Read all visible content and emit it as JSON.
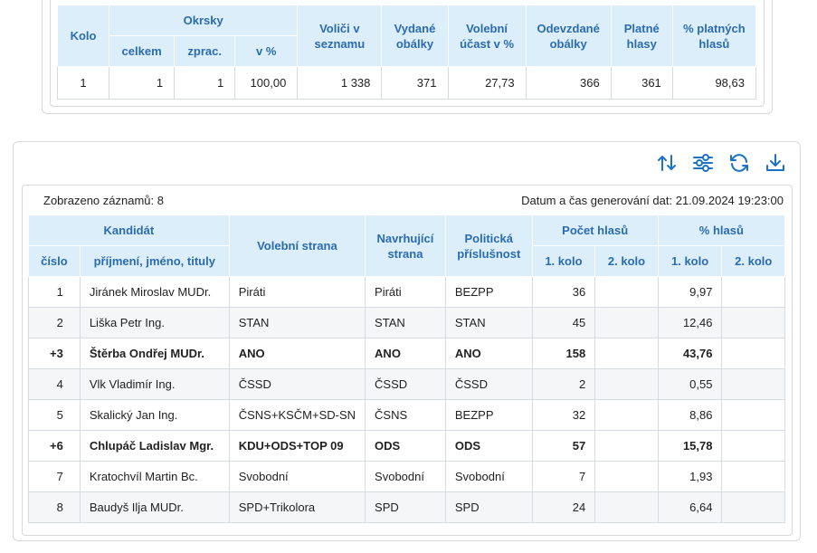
{
  "summary": {
    "headers": {
      "kolo": "Kolo",
      "okrsky": "Okrsky",
      "celkem": "celkem",
      "zprac": "zprac.",
      "v_pct": "v %",
      "volici": "Voliči v seznamu",
      "vydane": "Vydané obálky",
      "ucast": "Volební účast v %",
      "odevzdane": "Odevzdané obálky",
      "platne": "Platné hlasy",
      "pct_platnych": "% platných hlasů"
    },
    "row": {
      "kolo": "1",
      "celkem": "1",
      "zprac": "1",
      "v_pct": "100,00",
      "volici": "1 338",
      "vydane": "371",
      "ucast": "27,73",
      "odevzdane": "366",
      "platne": "361",
      "pct_platnych": "98,63"
    }
  },
  "toolbar": {
    "sort_icon": "sort-icon",
    "filter_icon": "filter-settings-icon",
    "refresh_icon": "refresh-icon",
    "download_icon": "download-icon"
  },
  "meta": {
    "records": "Zobrazeno záznamů: 8",
    "generated": "Datum a čas generování dat: 21.09.2024 19:23:00"
  },
  "candidates": {
    "headers": {
      "kandidat": "Kandidát",
      "cislo": "číslo",
      "jmeno": "příjmení, jméno, tituly",
      "strana": "Volební strana",
      "navrhujici": "Navrhující strana",
      "prislusnost": "Politická příslušnost",
      "pocet": "Počet hlasů",
      "pct": "% hlasů",
      "kolo1": "1. kolo",
      "kolo2": "2. kolo"
    },
    "rows": [
      {
        "cislo": "1",
        "jmeno": "Jiránek Miroslav MUDr.",
        "strana": "Piráti",
        "navrhujici": "Piráti",
        "prislusnost": "BEZPP",
        "hlasy1": "36",
        "hlasy2": "",
        "pct1": "9,97",
        "pct2": ""
      },
      {
        "cislo": "2",
        "jmeno": "Liška Petr Ing.",
        "strana": "STAN",
        "navrhujici": "STAN",
        "prislusnost": "STAN",
        "hlasy1": "45",
        "hlasy2": "",
        "pct1": "12,46",
        "pct2": ""
      },
      {
        "cislo": "+3",
        "jmeno": "Štěrba Ondřej MUDr.",
        "strana": "ANO",
        "navrhujici": "ANO",
        "prislusnost": "ANO",
        "hlasy1": "158",
        "hlasy2": "",
        "pct1": "43,76",
        "pct2": ""
      },
      {
        "cislo": "4",
        "jmeno": "Vlk Vladimír Ing.",
        "strana": "ČSSD",
        "navrhujici": "ČSSD",
        "prislusnost": "ČSSD",
        "hlasy1": "2",
        "hlasy2": "",
        "pct1": "0,55",
        "pct2": ""
      },
      {
        "cislo": "5",
        "jmeno": "Skalický Jan Ing.",
        "strana": "ČSNS+KSČM+SD-SN",
        "navrhujici": "ČSNS",
        "prislusnost": "BEZPP",
        "hlasy1": "32",
        "hlasy2": "",
        "pct1": "8,86",
        "pct2": ""
      },
      {
        "cislo": "+6",
        "jmeno": "Chlupáč Ladislav Mgr.",
        "strana": "KDU+ODS+TOP 09",
        "navrhujici": "ODS",
        "prislusnost": "ODS",
        "hlasy1": "57",
        "hlasy2": "",
        "pct1": "15,78",
        "pct2": ""
      },
      {
        "cislo": "7",
        "jmeno": "Kratochvíl Martin Bc.",
        "strana": "Svobodní",
        "navrhujici": "Svobodní",
        "prislusnost": "Svobodní",
        "hlasy1": "7",
        "hlasy2": "",
        "pct1": "1,93",
        "pct2": ""
      },
      {
        "cislo": "8",
        "jmeno": "Baudyš Ilja MUDr.",
        "strana": "SPD+Trikolora",
        "navrhujici": "SPD",
        "prislusnost": "SPD",
        "hlasy1": "24",
        "hlasy2": "",
        "pct1": "6,64",
        "pct2": ""
      }
    ]
  }
}
